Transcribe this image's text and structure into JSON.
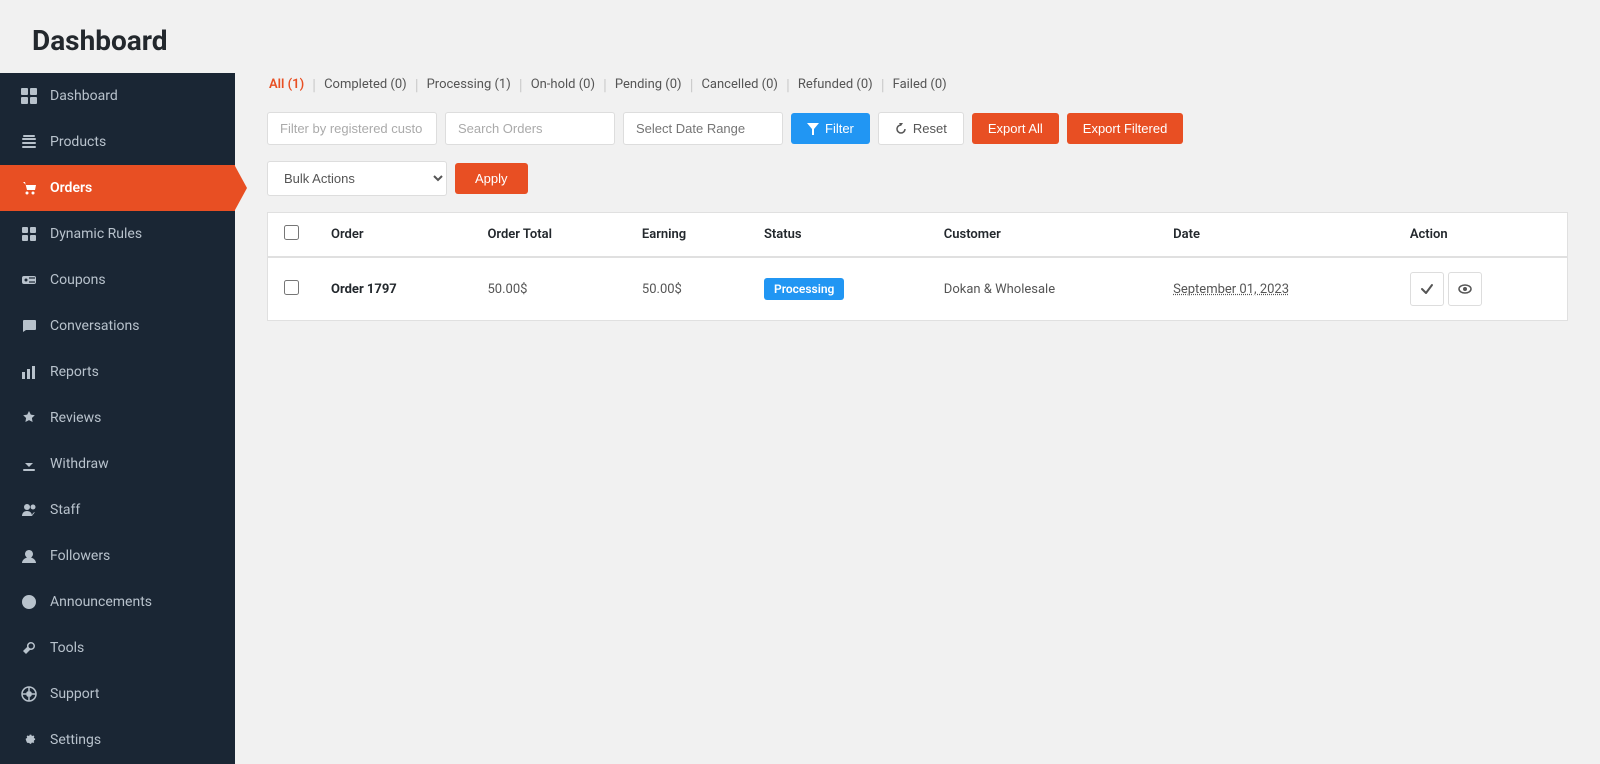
{
  "header": {
    "title": "Dashboard"
  },
  "sidebar": {
    "items": [
      {
        "id": "dashboard",
        "label": "Dashboard",
        "icon": "dashboard-icon"
      },
      {
        "id": "products",
        "label": "Products",
        "icon": "products-icon"
      },
      {
        "id": "orders",
        "label": "Orders",
        "icon": "orders-icon",
        "active": true
      },
      {
        "id": "dynamic-rules",
        "label": "Dynamic Rules",
        "icon": "dynamic-rules-icon"
      },
      {
        "id": "coupons",
        "label": "Coupons",
        "icon": "coupons-icon"
      },
      {
        "id": "conversations",
        "label": "Conversations",
        "icon": "conversations-icon"
      },
      {
        "id": "reports",
        "label": "Reports",
        "icon": "reports-icon"
      },
      {
        "id": "reviews",
        "label": "Reviews",
        "icon": "reviews-icon"
      },
      {
        "id": "withdraw",
        "label": "Withdraw",
        "icon": "withdraw-icon"
      },
      {
        "id": "staff",
        "label": "Staff",
        "icon": "staff-icon"
      },
      {
        "id": "followers",
        "label": "Followers",
        "icon": "followers-icon"
      },
      {
        "id": "announcements",
        "label": "Announcements",
        "icon": "announcements-icon"
      },
      {
        "id": "tools",
        "label": "Tools",
        "icon": "tools-icon"
      },
      {
        "id": "support",
        "label": "Support",
        "icon": "support-icon"
      },
      {
        "id": "settings",
        "label": "Settings",
        "icon": "settings-icon"
      }
    ]
  },
  "status_tabs": [
    {
      "id": "all",
      "label": "All (1)",
      "active": true
    },
    {
      "id": "completed",
      "label": "Completed (0)"
    },
    {
      "id": "processing",
      "label": "Processing (1)"
    },
    {
      "id": "on-hold",
      "label": "On-hold (0)"
    },
    {
      "id": "pending",
      "label": "Pending (0)"
    },
    {
      "id": "cancelled",
      "label": "Cancelled (0)"
    },
    {
      "id": "refunded",
      "label": "Refunded (0)"
    },
    {
      "id": "failed",
      "label": "Failed (0)"
    }
  ],
  "filter": {
    "customer_placeholder": "Filter by registered custo",
    "search_placeholder": "Search Orders",
    "date_placeholder": "Select Date Range",
    "filter_label": "Filter",
    "reset_label": "Reset",
    "export_all_label": "Export All",
    "export_filtered_label": "Export Filtered"
  },
  "bulk": {
    "placeholder": "Bulk Actions",
    "apply_label": "Apply"
  },
  "table": {
    "columns": [
      "",
      "Order",
      "Order Total",
      "Earning",
      "Status",
      "Customer",
      "Date",
      "Action"
    ],
    "rows": [
      {
        "id": "order-1797",
        "order": "Order 1797",
        "order_total": "50.00$",
        "earning": "50.00$",
        "status": "Processing",
        "status_class": "processing",
        "customer": "Dokan & Wholesale",
        "date": "September 01, 2023"
      }
    ]
  }
}
